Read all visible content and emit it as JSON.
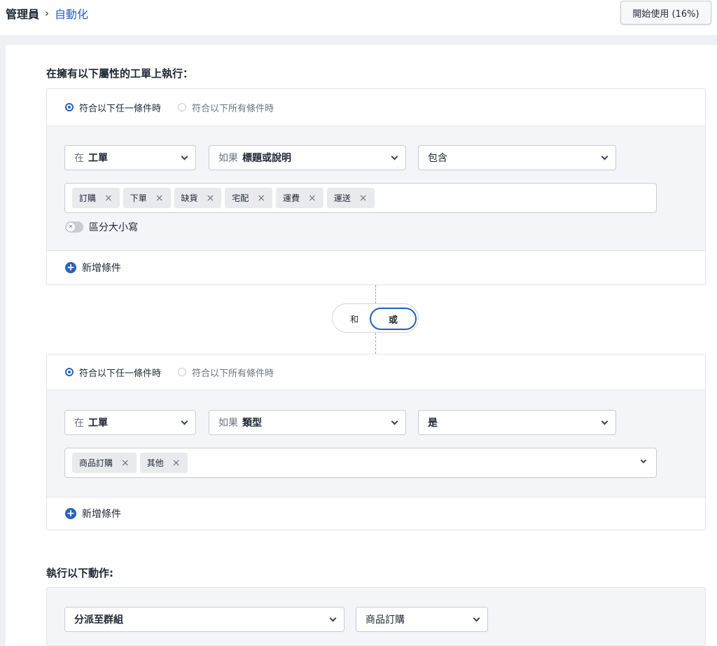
{
  "breadcrumb": {
    "root": "管理員",
    "separator": "›",
    "current": "自動化"
  },
  "start_button": "開始使用 (16%)",
  "conditions_title": "在擁有以下屬性的工單上執行：",
  "groups": [
    {
      "radio_any": "符合以下任一條件時",
      "radio_all": "符合以下所有條件時",
      "selected_radio": "any",
      "select_scope": {
        "prefix": "在",
        "value": "工單"
      },
      "select_field": {
        "prefix": "如果",
        "value": "標題或說明"
      },
      "select_operator": {
        "value": "包含"
      },
      "tags": [
        "訂購",
        "下單",
        "缺貨",
        "宅配",
        "運費",
        "運送"
      ],
      "case_toggle_label": "區分大小寫",
      "add_condition": "新增條件"
    },
    {
      "radio_any": "符合以下任一條件時",
      "radio_all": "符合以下所有條件時",
      "selected_radio": "any",
      "select_scope": {
        "prefix": "在",
        "value": "工單"
      },
      "select_field": {
        "prefix": "如果",
        "value": "類型"
      },
      "select_operator": {
        "value": "是"
      },
      "tags": [
        "商品訂購",
        "其他"
      ],
      "add_condition": "新增條件"
    }
  ],
  "logic": {
    "and_label": "和",
    "or_label": "或",
    "selected": "or"
  },
  "actions_title": "執行以下動作:",
  "action": {
    "type_value": "分派至群組",
    "target_value": "商品訂購"
  },
  "icons": {
    "chevron": "chevron-down-icon",
    "tag_remove": "close-icon",
    "add": "plus-circle-icon",
    "breadcrumb_sep": "chevron-right-icon"
  },
  "colors": {
    "accent": "#2a61c0",
    "background": "#eef0f4",
    "panel": "#f4f5f8"
  }
}
